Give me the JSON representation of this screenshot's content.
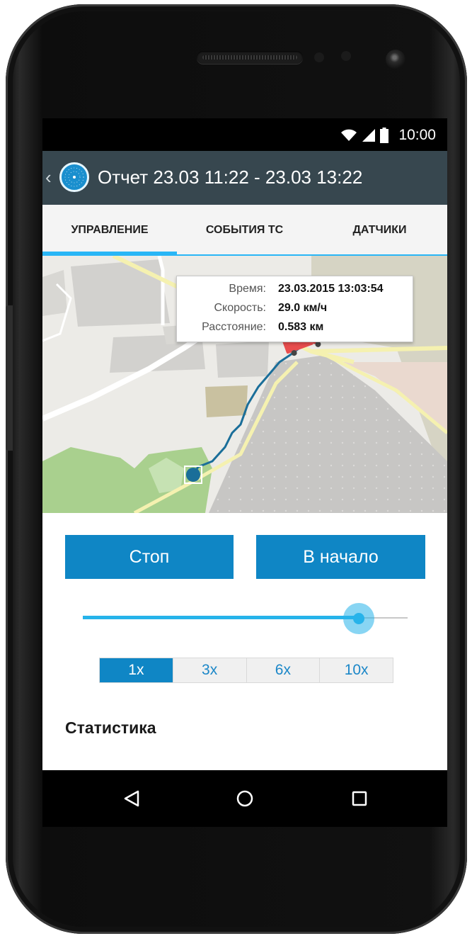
{
  "status_bar": {
    "time": "10:00",
    "icons": [
      "wifi-icon",
      "signal-icon",
      "battery-icon"
    ]
  },
  "app_bar": {
    "title": "Отчет 23.03 11:22 - 23.03 13:22",
    "back_icon": "chevron-left-icon",
    "logo_icon": "radar-logo-icon"
  },
  "tabs": [
    {
      "label": "УПРАВЛЕНИЕ",
      "selected": true
    },
    {
      "label": "СОБЫТИЯ ТС",
      "selected": false
    },
    {
      "label": "ДАТЧИКИ",
      "selected": false
    }
  ],
  "map": {
    "tooltip": {
      "time_label": "Время:",
      "time_value": "23.03.2015 13:03:54",
      "speed_label": "Скорость:",
      "speed_value": "29.0 км/ч",
      "distance_label": "Расстояние:",
      "distance_value": "0.583 км"
    },
    "vehicle_icon": "truck-icon",
    "start_marker_icon": "start-point-icon",
    "route_color": "#1a6e99"
  },
  "controls": {
    "stop_label": "Стоп",
    "start_label": "В начало",
    "progress": 0.85,
    "speeds": [
      "1x",
      "3x",
      "6x",
      "10x"
    ],
    "selected_speed": "1x"
  },
  "stats": {
    "title": "Статистика"
  },
  "nav": {
    "icons": [
      "back-triangle-icon",
      "home-circle-icon",
      "recents-square-icon"
    ]
  },
  "colors": {
    "accent": "#0f86c5",
    "app_bar": "#37474f",
    "tab_indicator": "#29b6f6"
  }
}
